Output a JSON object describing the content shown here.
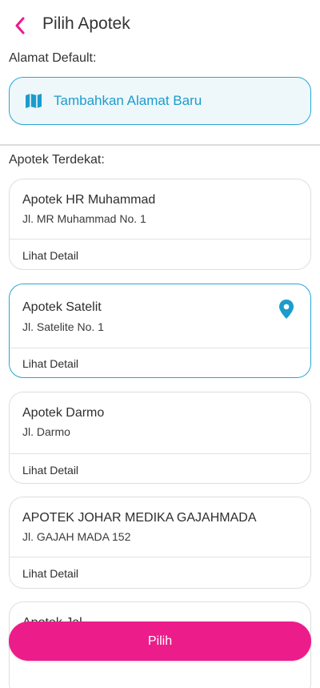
{
  "header": {
    "title": "Pilih Apotek",
    "back_icon": "chevron-left-icon",
    "accent": "#ec1c8a"
  },
  "default_address": {
    "label": "Alamat Default:",
    "add_button_label": "Tambahkan Alamat Baru",
    "add_button_icon": "map-icon",
    "accent": "#1c9ccc"
  },
  "nearby": {
    "label": "Apotek Terdekat:",
    "pharmacies": [
      {
        "name": "Apotek HR Muhammad",
        "address": "Jl. MR Muhammad No. 1",
        "detail_label": "Lihat Detail",
        "selected": false
      },
      {
        "name": "Apotek Satelit",
        "address": "Jl. Satelite No. 1",
        "detail_label": "Lihat Detail",
        "selected": true,
        "icon": "location-pin-icon"
      },
      {
        "name": "Apotek Darmo",
        "address": "Jl. Darmo",
        "detail_label": "Lihat Detail",
        "selected": false
      },
      {
        "name": "APOTEK JOHAR MEDIKA GAJAHMADA",
        "address": "Jl. GAJAH MADA 152",
        "detail_label": "Lihat Detail",
        "selected": false
      },
      {
        "name": "Apotek Jal",
        "address": "",
        "detail_label": "",
        "selected": false
      }
    ]
  },
  "footer": {
    "select_label": "Pilih",
    "color": "#ec1c8a"
  }
}
